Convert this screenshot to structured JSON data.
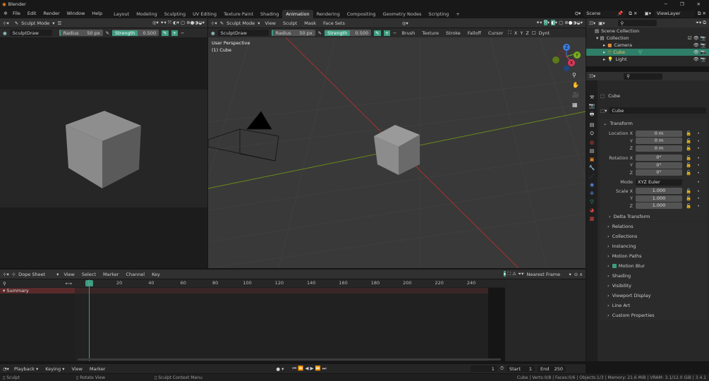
{
  "app": {
    "title": "Blender",
    "window_controls": [
      "minimize",
      "maximize",
      "close"
    ]
  },
  "menu": [
    "File",
    "Edit",
    "Render",
    "Window",
    "Help"
  ],
  "workspaces": [
    "Layout",
    "Modeling",
    "Sculpting",
    "UV Editing",
    "Texture Paint",
    "Shading",
    "Animation",
    "Rendering",
    "Compositing",
    "Geometry Nodes",
    "Scripting"
  ],
  "active_workspace": "Animation",
  "add_tab": "+",
  "scene": {
    "name": "Scene",
    "view_layer": "ViewLayer"
  },
  "left_editor": {
    "mode": "Sculpt Mode",
    "brush": "SculptDraw",
    "radius_label": "Radius",
    "radius": "50 px",
    "strength_label": "Strength",
    "strength": "0.500",
    "plus": "+",
    "minus": "−"
  },
  "viewport": {
    "mode": "Sculpt Mode",
    "menus": [
      "View",
      "Sculpt",
      "Mask",
      "Face Sets"
    ],
    "brush": "SculptDraw",
    "radius_label": "Radius",
    "radius": "50 px",
    "strength_label": "Strength",
    "strength": "0.500",
    "tool_menus": [
      "Brush",
      "Texture",
      "Stroke",
      "Falloff",
      "Cursor"
    ],
    "axes": [
      "X",
      "Y",
      "Z"
    ],
    "dyntopo": "Dynt",
    "overlay_title": "User Perspective",
    "overlay_sub": "(1) Cube",
    "gizmo": {
      "z": "Z",
      "y": "Y",
      "x": "X"
    }
  },
  "outliner": {
    "root": "Scene Collection",
    "collection": "Collection",
    "items": [
      {
        "name": "Camera",
        "selected": false
      },
      {
        "name": "Cube",
        "selected": true
      },
      {
        "name": "Light",
        "selected": false
      }
    ]
  },
  "properties": {
    "object_name": "Cube",
    "data_name": "Cube",
    "transform_label": "Transform",
    "location_label": "Location X",
    "rotation_label": "Rotation X",
    "scale_label": "Scale X",
    "y_label": "Y",
    "z_label": "Z",
    "location": [
      "0 m",
      "0 m",
      "0 m"
    ],
    "rotation": [
      "0°",
      "0°",
      "0°"
    ],
    "mode_label": "Mode",
    "mode": "XYZ Euler",
    "scale": [
      "1.000",
      "1.000",
      "1.000"
    ],
    "delta": "Delta Transform",
    "sections": [
      "Relations",
      "Collections",
      "Instancing",
      "Motion Paths",
      "Motion Blur",
      "Shading",
      "Visibility",
      "Viewport Display",
      "Line Art",
      "Custom Properties"
    ]
  },
  "dopesheet": {
    "editor": "Dope Sheet",
    "menus": [
      "View",
      "Select",
      "Marker",
      "Channel",
      "Key"
    ],
    "snap": "Nearest Frame",
    "current_frame": "1",
    "ticks": [
      "20",
      "40",
      "60",
      "80",
      "100",
      "120",
      "140",
      "160",
      "180",
      "200",
      "220",
      "240"
    ],
    "summary": "Summary"
  },
  "timeline": {
    "menus": [
      "Playback",
      "Keying",
      "View",
      "Marker"
    ],
    "frame": "1",
    "start_label": "Start",
    "start": "1",
    "end_label": "End",
    "end": "250"
  },
  "status": {
    "left": [
      "Sculpt",
      "Rotate View",
      "Sculpt Context Menu"
    ],
    "right": "Cube | Verts:0/8 | Faces:0/6 | Objects:1/3 | Memory: 21.6 MiB | VRAM: 3.1/12.0 GiB | 3.4.1"
  },
  "colors": {
    "accent": "#3e9c80",
    "selected_text": "#f5a623",
    "x_axis": "#c83a3a",
    "y_axis": "#7a9a1c"
  }
}
